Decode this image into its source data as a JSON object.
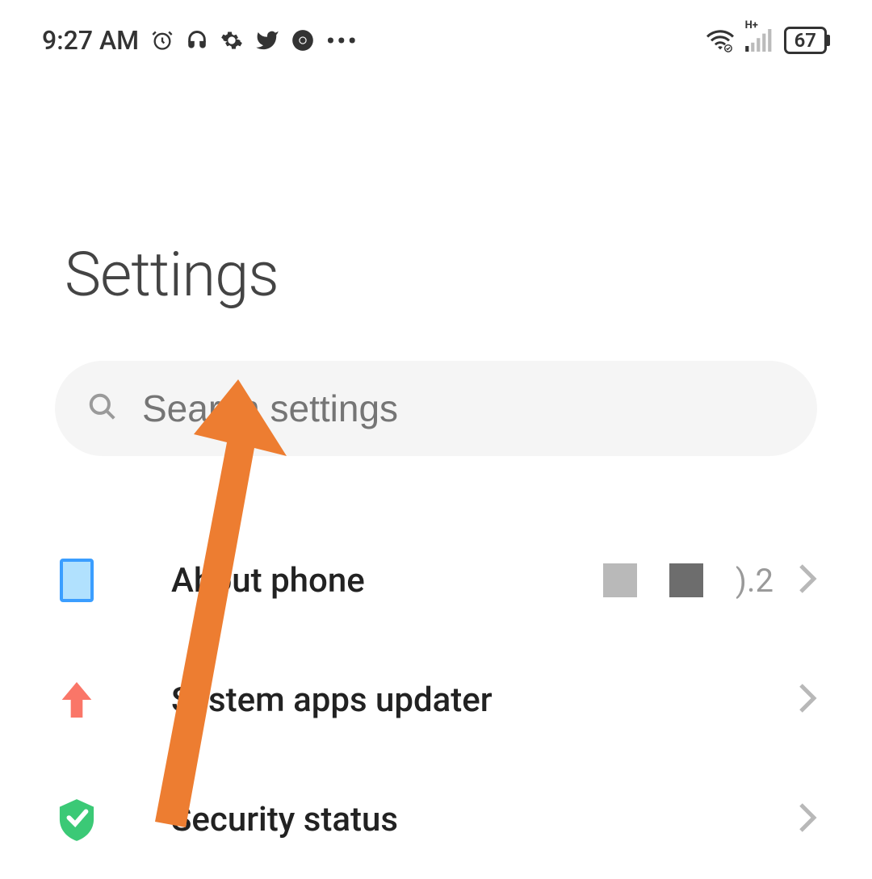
{
  "status_bar": {
    "time": "9:27 AM",
    "signal_label": "H+",
    "battery": "67",
    "icons": {
      "alarm": "alarm",
      "headphones": "headphones",
      "gear": "gear",
      "twitter": "twitter",
      "chrome": "chrome"
    }
  },
  "page": {
    "title": "Settings"
  },
  "search": {
    "placeholder": "Search settings"
  },
  "items": [
    {
      "label": "About phone",
      "value_suffix": ").2"
    },
    {
      "label": "System apps updater"
    },
    {
      "label": "Security status"
    }
  ]
}
